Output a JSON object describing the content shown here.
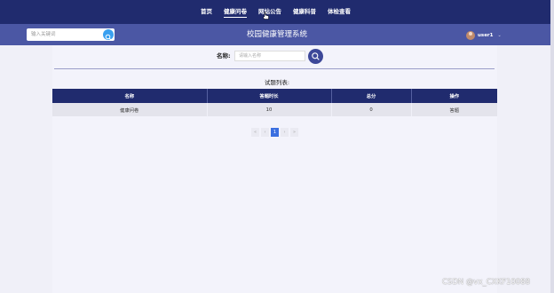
{
  "topnav": {
    "items": [
      {
        "label": "首页"
      },
      {
        "label": "健康问卷"
      },
      {
        "label": "网站公告"
      },
      {
        "label": "健康科普"
      },
      {
        "label": "体检查看"
      }
    ],
    "active_index": 1
  },
  "header": {
    "search_placeholder": "输入关键词",
    "site_title": "校园健康管理系统",
    "user_name": "user1",
    "user_caret": "⌄"
  },
  "filter": {
    "label": "名称:",
    "placeholder": "请输入名称"
  },
  "list": {
    "title": "试题列表:",
    "columns": [
      "名称",
      "答题时长",
      "总分",
      "操作"
    ],
    "rows": [
      {
        "name": "健康问卷",
        "duration": "10",
        "score": "0",
        "action": "答题"
      }
    ]
  },
  "pagination": {
    "first": "«",
    "prev": "‹",
    "current": "1",
    "next": "›",
    "last": "»"
  },
  "watermark": "CSDN @vx_CXKF10088"
}
